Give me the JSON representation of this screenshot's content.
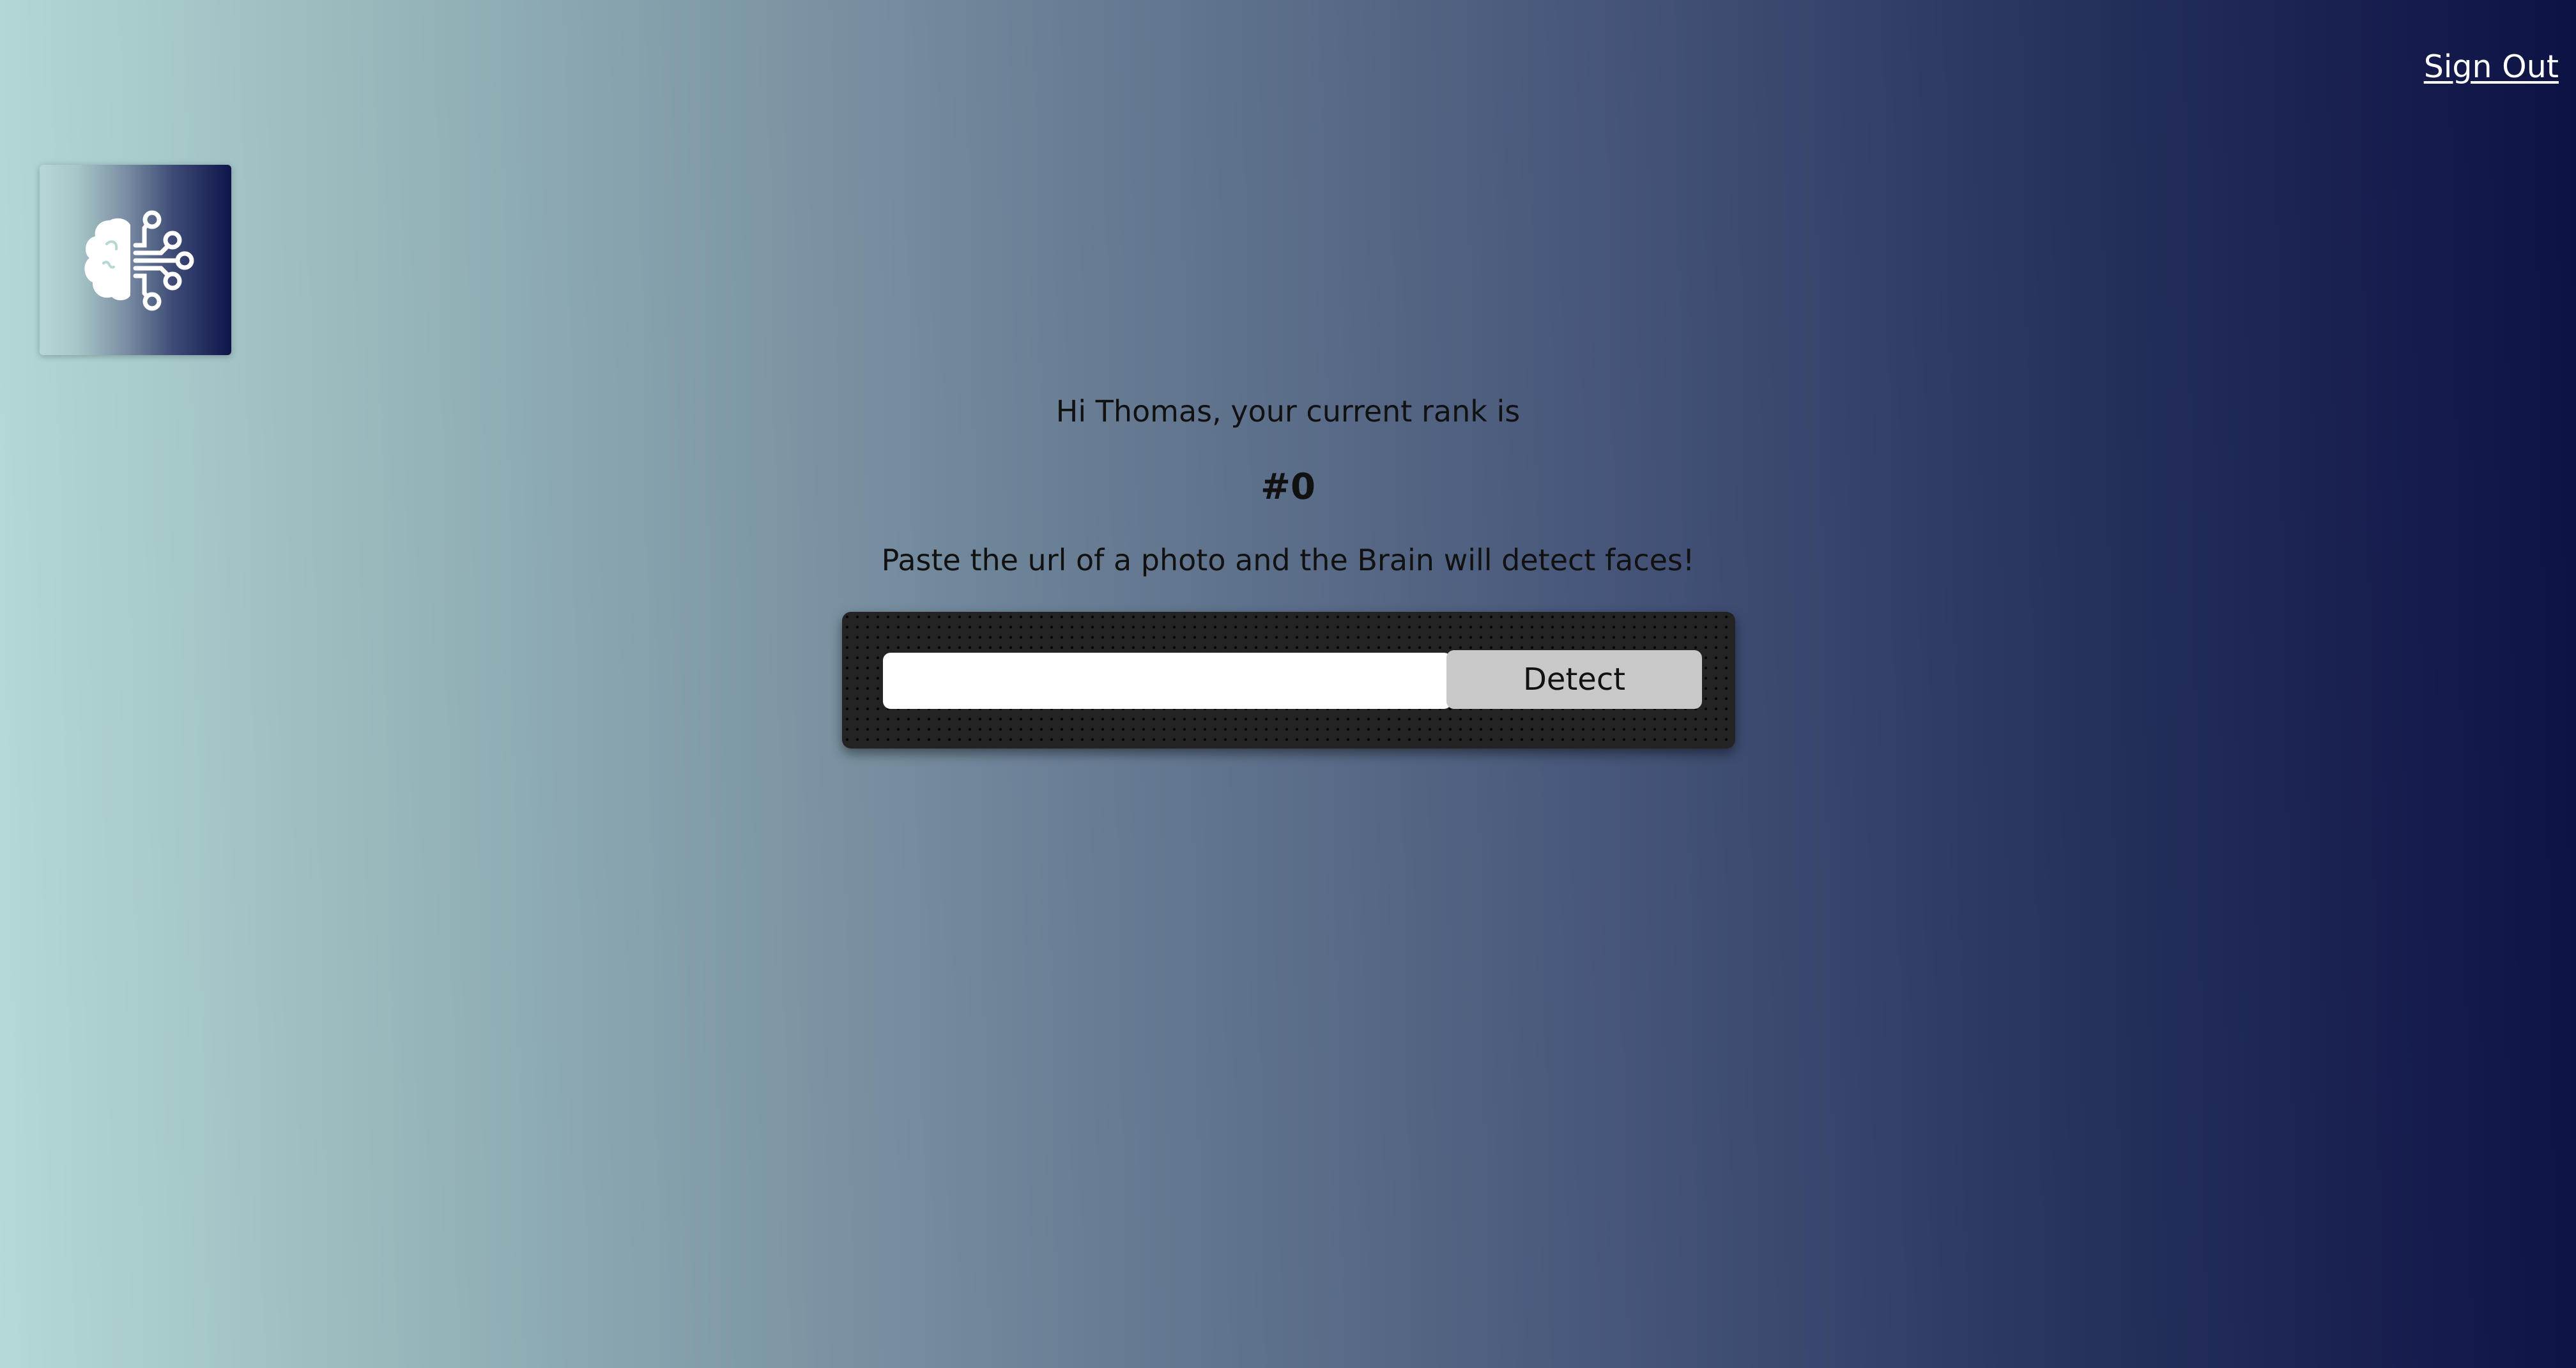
{
  "nav": {
    "sign_out_label": "Sign Out"
  },
  "logo": {
    "icon": "brain-circuit-icon"
  },
  "main": {
    "greeting": "Hi Thomas, your current rank is",
    "rank": "#0",
    "instructions": "Paste the url of a photo and the Brain will detect faces!",
    "url_input_value": "",
    "url_input_placeholder": "",
    "detect_label": "Detect"
  },
  "colors": {
    "gradient_start": "#b4d9d6",
    "gradient_end": "#0d1245",
    "panel": "#232323",
    "button": "#c8c8c8"
  }
}
